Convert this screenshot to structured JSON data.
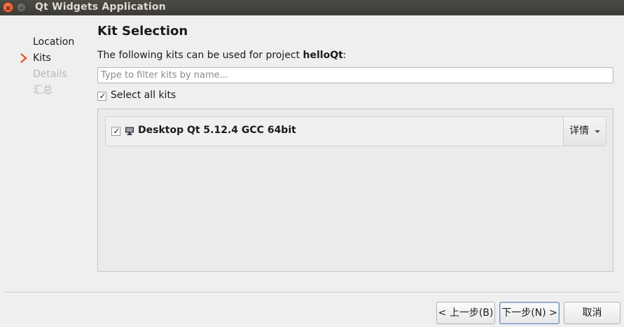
{
  "window": {
    "title": "Qt Widgets Application",
    "close_glyph": "×",
    "minimize_glyph": "–"
  },
  "sidebar": {
    "steps": [
      {
        "label": "Location",
        "state": "done"
      },
      {
        "label": "Kits",
        "state": "active"
      },
      {
        "label": "Details",
        "state": "pending"
      },
      {
        "label": "汇总",
        "state": "pending"
      }
    ],
    "active_icon": "chevron-right-icon",
    "accent_color": "#e95420"
  },
  "page": {
    "title": "Kit Selection",
    "intro_prefix": "The following kits can be used for project ",
    "project_name": "helloQt",
    "intro_suffix": ":"
  },
  "filter": {
    "placeholder": "Type to filter kits by name...",
    "value": ""
  },
  "select_all": {
    "label": "Select all kits",
    "checked": true,
    "check_glyph": "✓"
  },
  "kits": [
    {
      "name": "Desktop Qt 5.12.4 GCC 64bit",
      "checked": true,
      "icon": "desktop-monitor-icon",
      "details_label": "详情"
    }
  ],
  "buttons": {
    "back": "< 上一步(B)",
    "next": "下一步(N) >",
    "cancel": "取消"
  }
}
